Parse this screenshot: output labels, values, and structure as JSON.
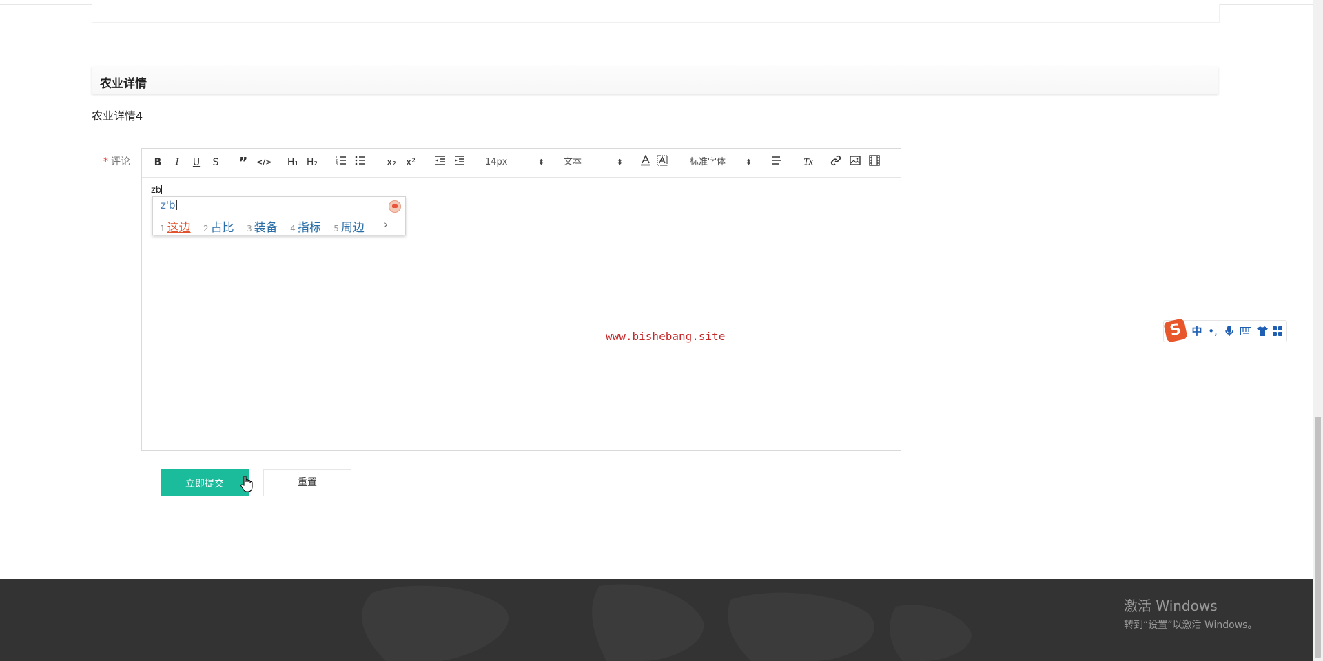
{
  "section": {
    "title": "农业详情"
  },
  "detail": {
    "text": "农业详情4"
  },
  "form": {
    "comment_label": "评论",
    "required_mark": "*",
    "submit_label": "立即提交",
    "reset_label": "重置"
  },
  "editor": {
    "toolbar": {
      "bold": "B",
      "italic": "I",
      "underline": "U",
      "strike": "S",
      "quote": "”",
      "code": "</>",
      "h1": "H₁",
      "h2": "H₂",
      "subscript": "x₂",
      "superscript": "x²",
      "font_size_value": "14px",
      "header_value": "文本",
      "font_family_value": "标准字体",
      "clear_format": "Tx"
    },
    "content": "zb",
    "watermark": "www.bishebang.site"
  },
  "ime": {
    "input": "z'b",
    "candidates": [
      {
        "num": "1",
        "word": "这边"
      },
      {
        "num": "2",
        "word": "占比"
      },
      {
        "num": "3",
        "word": "装备"
      },
      {
        "num": "4",
        "word": "指标"
      },
      {
        "num": "5",
        "word": "周边"
      }
    ],
    "next": "›",
    "toolbar": {
      "logo": "S",
      "mode": "中",
      "punct": "•,",
      "icons": [
        "logo-icon",
        "mode-chinese",
        "punctuation-icon",
        "microphone-icon",
        "keyboard-icon",
        "skin-icon",
        "toolbox-icon"
      ]
    },
    "accent_color": "#e8572b"
  },
  "os": {
    "activate_title": "激活 Windows",
    "activate_sub": "转到“设置”以激活 Windows。"
  },
  "colors": {
    "primary": "#1abc9c",
    "footer": "#333333",
    "required": "#e64340",
    "watermark": "#c62828"
  }
}
